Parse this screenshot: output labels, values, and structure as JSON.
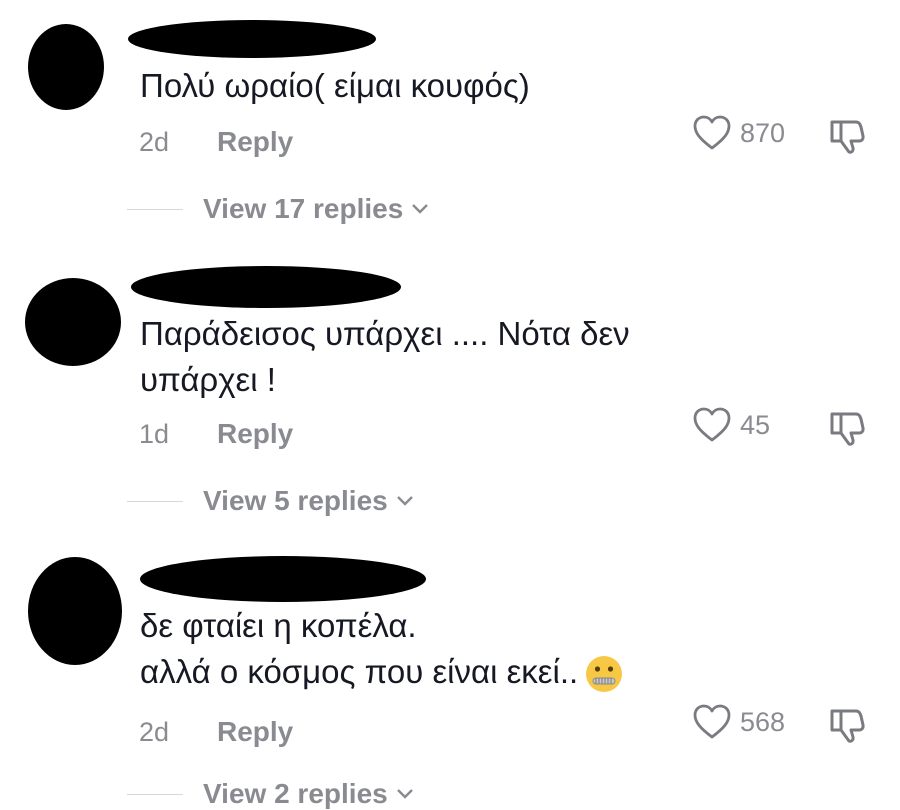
{
  "comments": [
    {
      "text": "Πολύ ωραίο( είμαι κουφός)",
      "time": "2d",
      "reply_label": "Reply",
      "likes": "870",
      "view_replies": "View 17 replies"
    },
    {
      "text": "Παράδεισος υπάρχει .... Νότα δεν\nυπάρχει !",
      "time": "1d",
      "reply_label": "Reply",
      "likes": "45",
      "view_replies": "View 5 replies"
    },
    {
      "text": "δε φταίει η κοπέλα.\nαλλά ο κόσμος που είναι εκεί..",
      "time": "2d",
      "reply_label": "Reply",
      "likes": "568",
      "view_replies": "View 2 replies",
      "emoji": "zipper-mouth-face"
    }
  ],
  "colors": {
    "text": "#161823",
    "muted": "#8a8b91",
    "divider": "#d7d8da",
    "redaction": "#000000"
  }
}
